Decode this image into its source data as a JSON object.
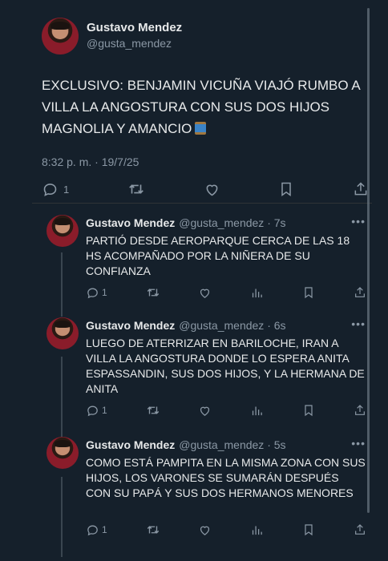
{
  "tweet": {
    "author_name": "Gustavo Mendez",
    "author_handle": "@gusta_mendez",
    "text": "EXCLUSIVO: BENJAMIN VICUÑA VIAJÓ RUMBO A VILLA LA ANGOSTURA CON SUS DOS HIJOS MAGNOLIA Y AMANCIO",
    "timestamp": "8:32 p. m. · 19/7/25",
    "reply_count": "1"
  },
  "replies": [
    {
      "name": "Gustavo Mendez",
      "meta": "@gusta_mendez · 7s",
      "text": "PARTIÓ DESDE AEROPARQUE CERCA DE LAS 18 HS ACOMPAÑADO POR LA NIÑERA DE SU CONFIANZA",
      "reply_count": "1"
    },
    {
      "name": "Gustavo Mendez",
      "meta": "@gusta_mendez · 6s",
      "text": "LUEGO DE ATERRIZAR EN BARILOCHE, IRAN A VILLA LA ANGOSTURA DONDE LO ESPERA ANITA ESPASSANDIN, SUS DOS HIJOS, Y LA HERMANA DE ANITA",
      "reply_count": "1"
    },
    {
      "name": "Gustavo Mendez",
      "meta": "@gusta_mendez · 5s",
      "text": "COMO ESTÁ PAMPITA EN LA MISMA ZONA CON SUS HIJOS, LOS VARONES SE SUMARÁN DESPUÉS CON SU PAPÁ Y SUS DOS HERMANOS MENORES",
      "reply_count": "1"
    }
  ],
  "icons": {
    "reply": "reply-icon",
    "retweet": "retweet-icon",
    "like": "like-icon",
    "bookmark": "bookmark-icon",
    "share": "share-icon",
    "views": "views-icon",
    "more": "more-icon",
    "spool": "thread-spool-emoji"
  },
  "colors": {
    "background": "#15202b",
    "text": "#e7e9ea",
    "muted": "#8b98a5"
  }
}
